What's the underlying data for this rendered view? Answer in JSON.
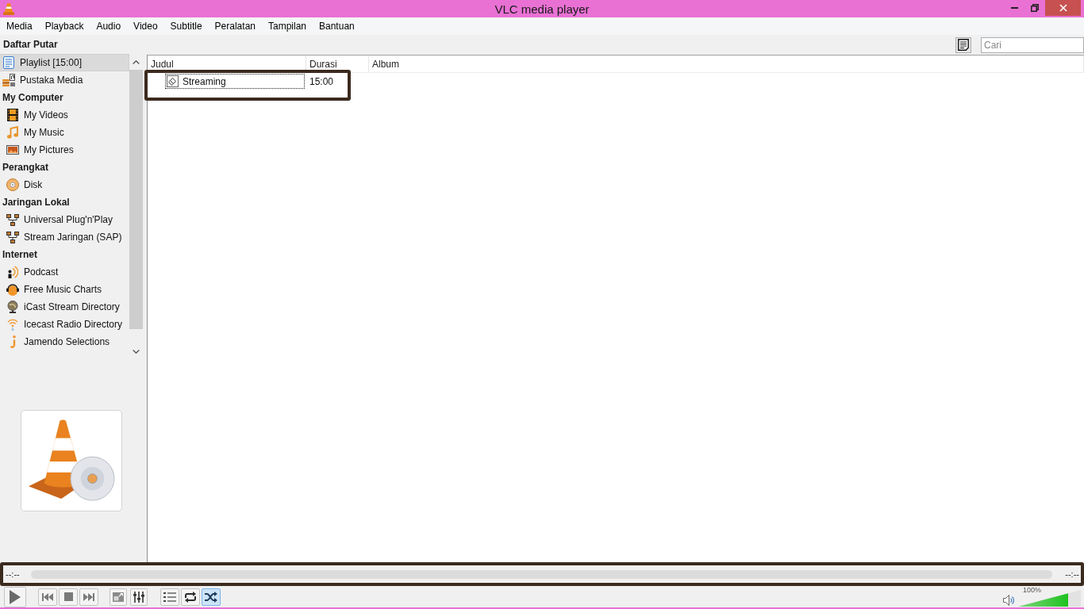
{
  "window": {
    "title": "VLC media player"
  },
  "menu": [
    "Media",
    "Playback",
    "Audio",
    "Video",
    "Subtitle",
    "Peralatan",
    "Tampilan",
    "Bantuan"
  ],
  "sidebar": {
    "playlist_heading": "Daftar Putar",
    "playlist_items": [
      {
        "label": "Playlist [15:00]",
        "kind": "playlist",
        "selected": true
      },
      {
        "label": "Pustaka Media",
        "kind": "library",
        "selected": false
      }
    ],
    "sections": [
      {
        "heading": "My Computer",
        "items": [
          {
            "label": "My Videos",
            "kind": "video",
            "selected": false
          },
          {
            "label": "My Music",
            "kind": "music",
            "selected": false
          },
          {
            "label": "My Pictures",
            "kind": "pictures",
            "selected": false
          }
        ]
      },
      {
        "heading": "Perangkat",
        "items": [
          {
            "label": "Disk",
            "kind": "disc",
            "selected": false
          }
        ]
      },
      {
        "heading": "Jaringan Lokal",
        "items": [
          {
            "label": "Universal Plug'n'Play",
            "kind": "network",
            "selected": false
          },
          {
            "label": "Stream Jaringan (SAP)",
            "kind": "network",
            "selected": false
          }
        ]
      },
      {
        "heading": "Internet",
        "items": [
          {
            "label": "Podcast",
            "kind": "podcast",
            "selected": false
          },
          {
            "label": "Free Music Charts",
            "kind": "headphones",
            "selected": false
          },
          {
            "label": "iCast Stream Directory",
            "kind": "globe",
            "selected": false
          },
          {
            "label": "Icecast Radio Directory",
            "kind": "antenna",
            "selected": false
          },
          {
            "label": "Jamendo Selections",
            "kind": "hook",
            "selected": false
          }
        ]
      }
    ]
  },
  "toolbar": {
    "search": {
      "placeholder": "Cari"
    }
  },
  "playlist": {
    "columns": [
      "Judul",
      "Durasi",
      "Album"
    ],
    "rows": [
      {
        "title": "Streaming",
        "duration": "15:00",
        "focused": true
      }
    ]
  },
  "seek": {
    "elapsed": "--:--",
    "remaining": "--:--",
    "level": 0
  },
  "controls": {
    "toggles": [
      {
        "kind": "playlist",
        "on": false
      },
      {
        "kind": "loop",
        "on": false
      },
      {
        "kind": "random",
        "on": true
      }
    ]
  },
  "volume": {
    "reading": "100%",
    "level": 0.8
  }
}
